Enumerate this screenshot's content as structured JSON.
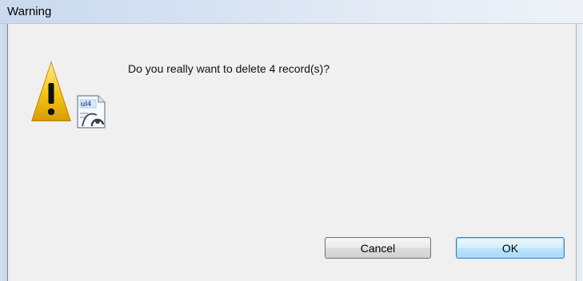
{
  "window": {
    "title": "Warning"
  },
  "dialog": {
    "message": "Do you really want to delete 4 record(s)?",
    "icon": "warning-document-icon"
  },
  "buttons": {
    "cancel_label": "Cancel",
    "ok_label": "OK"
  },
  "colors": {
    "warning_yellow": "#f2c20f",
    "ok_button_border": "#3c7fb1"
  }
}
